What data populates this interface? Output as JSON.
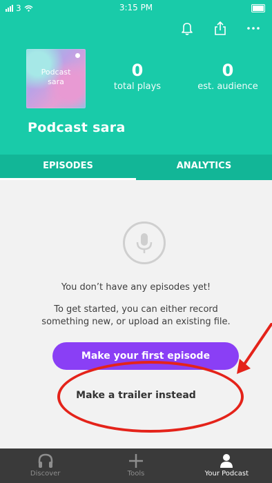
{
  "status": {
    "carrier": "3",
    "time": "3:15 PM"
  },
  "toolbar": {
    "icons": [
      "bell-icon",
      "share-icon",
      "more-icon"
    ]
  },
  "podcast": {
    "cover_text": "Podcast\nsara",
    "name": "Podcast sara",
    "stats": [
      {
        "value": "0",
        "label": "total plays"
      },
      {
        "value": "0",
        "label": "est. audience"
      }
    ]
  },
  "tabs": [
    {
      "label": "EPISODES",
      "active": true
    },
    {
      "label": "ANALYTICS",
      "active": false
    }
  ],
  "empty_state": {
    "title": "You don’t have any episodes yet!",
    "description": "To get started, you can either record something new, or upload an existing file.",
    "primary_button": "Make your first episode",
    "secondary_link": "Make a trailer instead"
  },
  "annotation": {
    "color": "#e4231a"
  },
  "bottom_nav": [
    {
      "label": "Discover",
      "icon": "headphones-icon",
      "active": false
    },
    {
      "label": "Tools",
      "icon": "plus-icon",
      "active": false
    },
    {
      "label": "Your Podcast",
      "icon": "person-icon",
      "active": true
    }
  ],
  "colors": {
    "header": "#19cba9",
    "tab_strip": "#12b697",
    "cta": "#8a3ff5",
    "nav": "#3a3a3a"
  }
}
